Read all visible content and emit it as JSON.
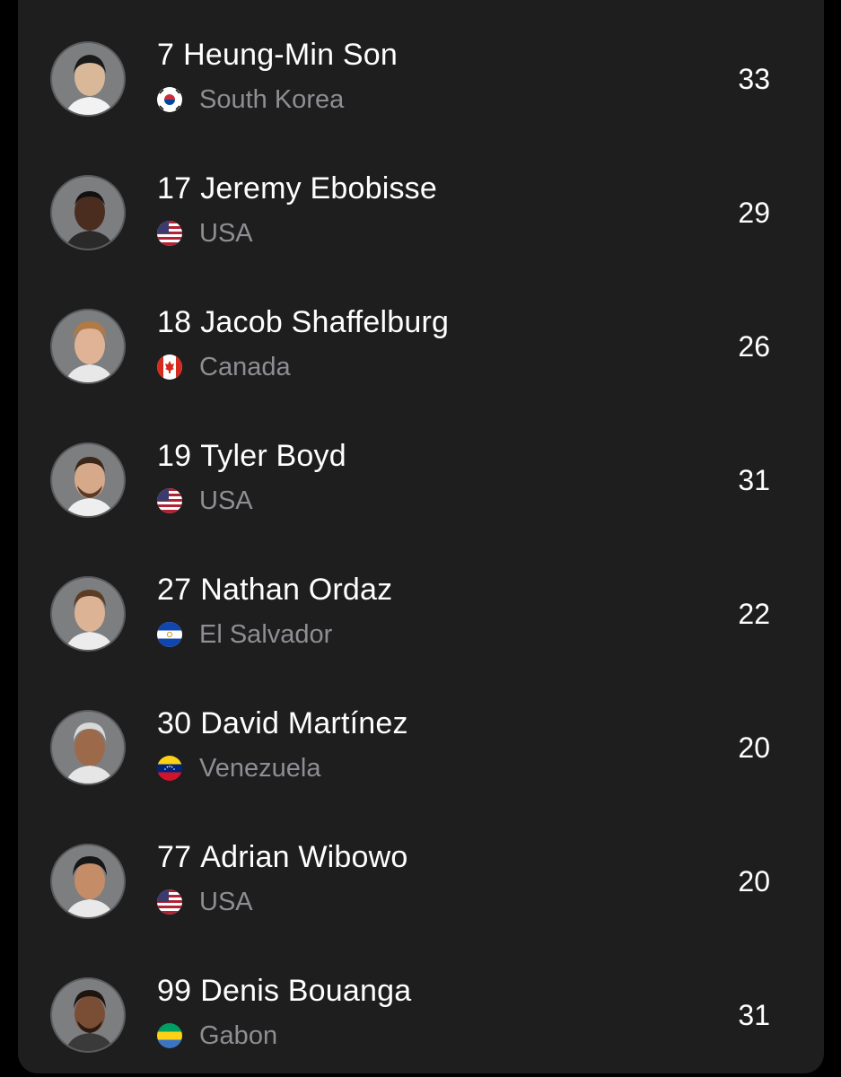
{
  "players": [
    {
      "number": "7",
      "name": "Heung-Min Son",
      "country": "South Korea",
      "flag": "south-korea-flag",
      "value": "33"
    },
    {
      "number": "17",
      "name": "Jeremy Ebobisse",
      "country": "USA",
      "flag": "usa-flag",
      "value": "29"
    },
    {
      "number": "18",
      "name": "Jacob Shaffelburg",
      "country": "Canada",
      "flag": "canada-flag",
      "value": "26"
    },
    {
      "number": "19",
      "name": "Tyler Boyd",
      "country": "USA",
      "flag": "usa-flag",
      "value": "31"
    },
    {
      "number": "27",
      "name": "Nathan Ordaz",
      "country": "El Salvador",
      "flag": "el-salvador-flag",
      "value": "22"
    },
    {
      "number": "30",
      "name": "David Martínez",
      "country": "Venezuela",
      "flag": "venezuela-flag",
      "value": "20"
    },
    {
      "number": "77",
      "name": "Adrian Wibowo",
      "country": "USA",
      "flag": "usa-flag",
      "value": "20"
    },
    {
      "number": "99",
      "name": "Denis Bouanga",
      "country": "Gabon",
      "flag": "gabon-flag",
      "value": "31"
    }
  ],
  "colors": {
    "background": "#000000",
    "card": "#1e1e1f",
    "primary_text": "#ffffff",
    "secondary_text": "#8e8e93",
    "avatar_bg": "#7d7e80"
  }
}
